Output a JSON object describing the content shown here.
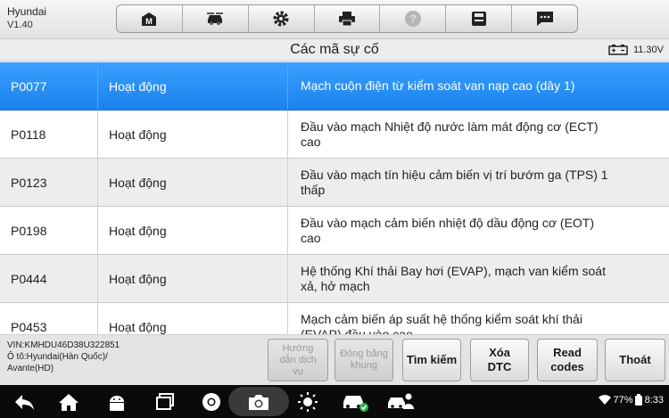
{
  "header": {
    "brand": "Hyundai",
    "version": "V1.40"
  },
  "toolbar": {
    "icons": [
      "home-icon",
      "vehicle-swap-icon",
      "settings-gear-icon",
      "print-icon",
      "help-icon",
      "save-icon",
      "message-icon"
    ]
  },
  "title": {
    "text": "Các mã sự cố",
    "voltage": "11.30V"
  },
  "dtc_rows": [
    {
      "code": "P0077",
      "status": "Hoạt động",
      "desc1": "Mạch cuộn điện từ kiểm soát van nạp cao (dây 1)",
      "desc2": ""
    },
    {
      "code": "P0118",
      "status": "Hoạt động",
      "desc1": "Đầu vào mạch Nhiệt độ nước làm mát động cơ (ECT)",
      "desc2": "cao"
    },
    {
      "code": "P0123",
      "status": "Hoạt động",
      "desc1": "Đầu vào mạch tín hiệu cảm biến vị trí bướm ga (TPS) 1",
      "desc2": "thấp"
    },
    {
      "code": "P0198",
      "status": "Hoạt động",
      "desc1": "Đầu vào mạch cảm biến nhiệt độ dầu động cơ (EOT)",
      "desc2": "cao"
    },
    {
      "code": "P0444",
      "status": "Hoạt động",
      "desc1": "Hệ thống Khí thải Bay hơi (EVAP), mạch van kiểm soát",
      "desc2": "xả, hở mạch"
    },
    {
      "code": "P0453",
      "status": "Hoạt động",
      "desc1": "Mạch cảm biến áp suất hệ thống kiểm soát khí thải",
      "desc2": "(EVAP) đầu vào cao"
    }
  ],
  "vehicle": {
    "vin": "VIN:KMHDU46D38U322851",
    "line2": "Ô tô:Hyundai(Hàn Quốc)/",
    "line3": "Avante(HD)"
  },
  "buttons": {
    "guide_l1": "Hướng",
    "guide_l2": "dẫn dịch",
    "guide_l3": "vụ",
    "freeze_l1": "Đóng băng",
    "freeze_l2": "khung",
    "search": "Tìm kiếm",
    "clear_l1": "Xóa",
    "clear_l2": "DTC",
    "read_l1": "Read",
    "read_l2": "codes",
    "exit": "Thoát"
  },
  "system": {
    "battery": "77%",
    "time": "8:33"
  }
}
